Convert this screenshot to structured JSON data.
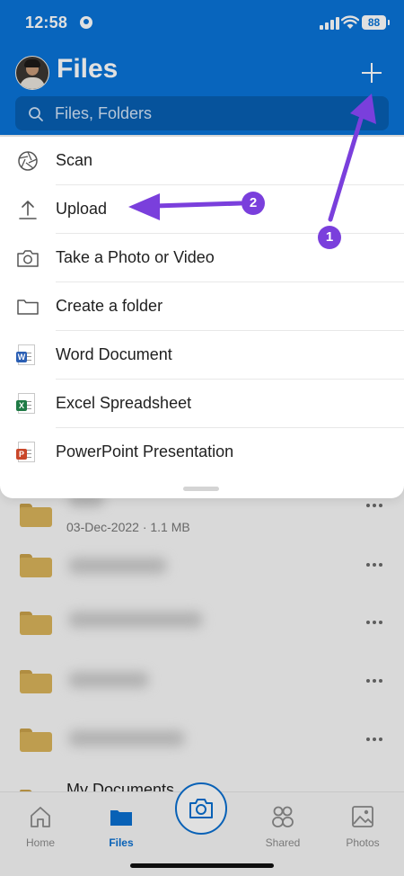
{
  "status_bar": {
    "time": "12:58",
    "battery": "88"
  },
  "header": {
    "title": "Files",
    "search_placeholder": "Files, Folders"
  },
  "menu": {
    "items": [
      {
        "label": "Scan",
        "icon": "aperture-icon"
      },
      {
        "label": "Upload",
        "icon": "upload-icon"
      },
      {
        "label": "Take a Photo or Video",
        "icon": "camera-icon"
      },
      {
        "label": "Create a folder",
        "icon": "folder-icon"
      },
      {
        "label": "Word Document",
        "icon": "word-icon"
      },
      {
        "label": "Excel Spreadsheet",
        "icon": "excel-icon"
      },
      {
        "label": "PowerPoint Presentation",
        "icon": "powerpoint-icon"
      }
    ]
  },
  "file_list": {
    "first_meta": "03-Dec-2022 · 1.1 MB",
    "last_name": "My Documents"
  },
  "tabbar": {
    "home": "Home",
    "files": "Files",
    "shared": "Shared",
    "photos": "Photos"
  },
  "annotations": {
    "step1": "1",
    "step2": "2",
    "arrow_color": "#7a3fdc"
  },
  "colors": {
    "brand_blue": "#0a74d8",
    "folder": "#d9b35a"
  }
}
